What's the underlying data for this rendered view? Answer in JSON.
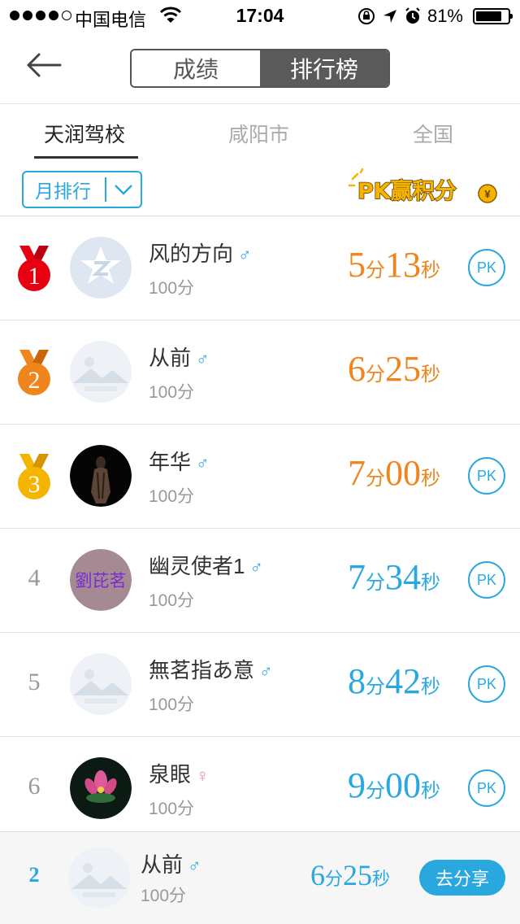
{
  "status": {
    "carrier": "中国电信",
    "time": "17:04",
    "battery": "81%"
  },
  "nav": {
    "seg_scores": "成绩",
    "seg_ranking": "排行榜"
  },
  "tabs": [
    "天润驾校",
    "咸阳市",
    "全国"
  ],
  "filter": {
    "label": "月排行",
    "pk_banner": "PK赢积分"
  },
  "rows": [
    {
      "rank": "1",
      "name": "风的方向",
      "gender": "♂",
      "score": "100分",
      "min": "5",
      "min_unit": "分",
      "sec": "13",
      "sec_unit": "秒",
      "pk": "PK"
    },
    {
      "rank": "2",
      "name": "从前",
      "gender": "♂",
      "score": "100分",
      "min": "6",
      "min_unit": "分",
      "sec": "25",
      "sec_unit": "秒"
    },
    {
      "rank": "3",
      "name": "年华",
      "gender": "♂",
      "score": "100分",
      "min": "7",
      "min_unit": "分",
      "sec": "00",
      "sec_unit": "秒",
      "pk": "PK"
    },
    {
      "rank": "4",
      "name": "幽灵使者1",
      "gender": "♂",
      "score": "100分",
      "min": "7",
      "min_unit": "分",
      "sec": "34",
      "sec_unit": "秒",
      "pk": "PK",
      "avatar_text": "劉芘茗"
    },
    {
      "rank": "5",
      "name": "無茗指あ意",
      "gender": "♂",
      "score": "100分",
      "min": "8",
      "min_unit": "分",
      "sec": "42",
      "sec_unit": "秒",
      "pk": "PK"
    },
    {
      "rank": "6",
      "name": "泉眼",
      "gender": "♀",
      "score": "100分",
      "min": "9",
      "min_unit": "分",
      "sec": "00",
      "sec_unit": "秒",
      "pk": "PK"
    }
  ],
  "me": {
    "rank": "2",
    "name": "从前",
    "gender": "♂",
    "score": "100分",
    "min": "6",
    "min_unit": "分",
    "sec": "25",
    "sec_unit": "秒",
    "share": "去分享"
  },
  "colors": {
    "accent": "#29a8e0",
    "orange": "#f0841d",
    "gold": "#f5b400",
    "medal_red": "#e60012"
  }
}
